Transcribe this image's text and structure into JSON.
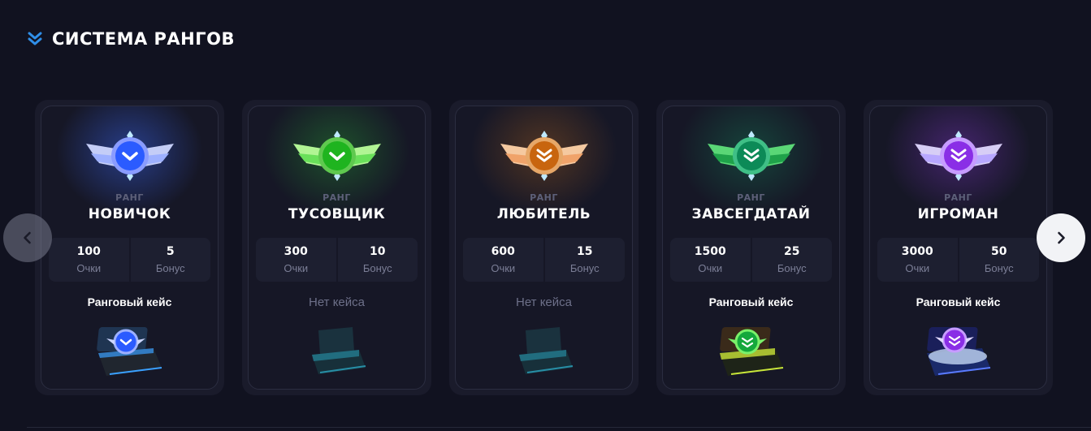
{
  "header": {
    "title": "СИСТЕМА РАНГОВ",
    "icon": "double-chevron-down-icon",
    "accent": "#2f8ee8"
  },
  "rank_caption": "РАНГ",
  "stat_labels": {
    "points": "Очки",
    "bonus": "Бонус"
  },
  "ranks": [
    {
      "name": "НОВИЧОК",
      "points": "100",
      "bonus": "5",
      "case": "Ранговый кейс",
      "has_case": true,
      "color": "#3d6bff",
      "badge_icon": "single-chevron-down-icon"
    },
    {
      "name": "ТУСОВЩИК",
      "points": "300",
      "bonus": "10",
      "case": "Нет кейса",
      "has_case": false,
      "color": "#2fd13a",
      "badge_icon": "single-chevron-down-icon"
    },
    {
      "name": "ЛЮБИТЕЛЬ",
      "points": "600",
      "bonus": "15",
      "case": "Нет кейса",
      "has_case": false,
      "color": "#d9791c",
      "badge_icon": "double-chevron-down-icon"
    },
    {
      "name": "ЗАВСЕГДАТАЙ",
      "points": "1500",
      "bonus": "25",
      "case": "Ранговый кейс",
      "has_case": true,
      "color": "#17a86a",
      "badge_icon": "double-chevron-down-icon"
    },
    {
      "name": "ИГРОМАН",
      "points": "3000",
      "bonus": "50",
      "case": "Ранговый кейс",
      "has_case": true,
      "color": "#9a3ef0",
      "badge_icon": "double-chevron-down-icon"
    }
  ],
  "nav": {
    "prev_icon": "chevron-left-icon",
    "next_icon": "chevron-right-icon"
  }
}
